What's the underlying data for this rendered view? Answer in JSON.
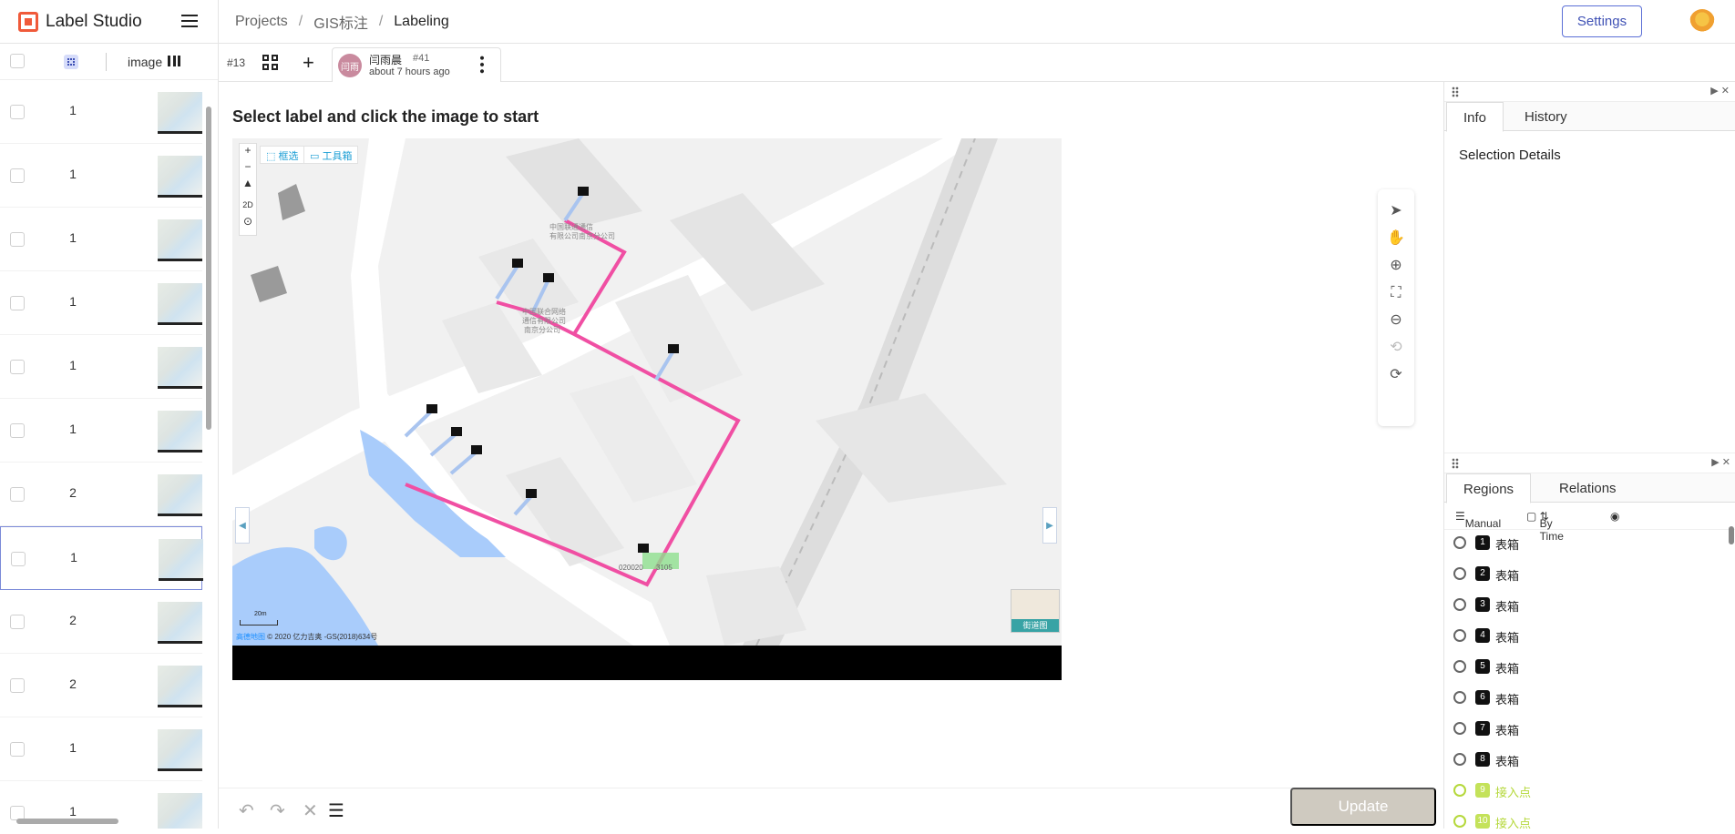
{
  "app": {
    "name": "Label Studio"
  },
  "breadcrumb": {
    "projects": "Projects",
    "project": "GIS标注",
    "page": "Labeling"
  },
  "header": {
    "settings_label": "Settings"
  },
  "task_list": {
    "column_label": "image",
    "rows": [
      {
        "value": "1"
      },
      {
        "value": "1"
      },
      {
        "value": "1"
      },
      {
        "value": "1"
      },
      {
        "value": "1"
      },
      {
        "value": "1"
      },
      {
        "value": "2"
      },
      {
        "value": "1",
        "selected": true
      },
      {
        "value": "2"
      },
      {
        "value": "2"
      },
      {
        "value": "1"
      },
      {
        "value": "1"
      }
    ]
  },
  "tabs": {
    "task_id": "#13",
    "annotation": {
      "avatar": "闫雨",
      "user": "闫雨晨",
      "id": "#41",
      "time": "about 7 hours ago"
    }
  },
  "main": {
    "instruction": "Select label and click the image to start"
  },
  "map": {
    "tool_select": "框选",
    "tool_box": "工具箱",
    "scale": "20m",
    "copyright_link": "高德地图",
    "copyright": "© 2020 亿力吉奥 -GS(2018)634号",
    "minimap_label": "街道图",
    "mode": "2D",
    "label_a": "中国联通通信",
    "label_b": "有限公司南京分公司",
    "label_c": "中国联合网络",
    "label_d": "通信有限公司",
    "label_e": "南京分公司",
    "label_f": "020020",
    "label_g": "3105"
  },
  "bottom": {
    "update_label": "Update"
  },
  "info_panel": {
    "tab_info": "Info",
    "tab_history": "History",
    "selection_title": "Selection Details"
  },
  "regions_panel": {
    "tab_regions": "Regions",
    "tab_relations": "Relations",
    "filter_manual": "Manual",
    "filter_bytime": "By Time",
    "items": [
      {
        "n": "1",
        "label": "表箱"
      },
      {
        "n": "2",
        "label": "表箱"
      },
      {
        "n": "3",
        "label": "表箱"
      },
      {
        "n": "4",
        "label": "表箱"
      },
      {
        "n": "5",
        "label": "表箱"
      },
      {
        "n": "6",
        "label": "表箱"
      },
      {
        "n": "7",
        "label": "表箱"
      },
      {
        "n": "8",
        "label": "表箱"
      },
      {
        "n": "9",
        "label": "接入点"
      },
      {
        "n": "10",
        "label": "接入点"
      }
    ]
  },
  "colors": {
    "accent": "#3f51b5",
    "route": "#f04fa3",
    "link": "#a9c4ef",
    "water": "#a9ccfb",
    "logo": "#f05a3a"
  }
}
